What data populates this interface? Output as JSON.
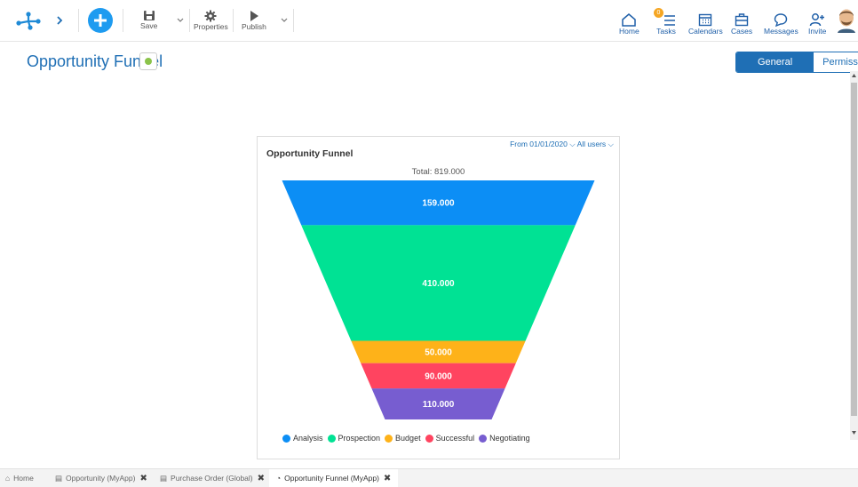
{
  "toolbar": {
    "save_label": "Save",
    "properties_label": "Properties",
    "publish_label": "Publish"
  },
  "nav": [
    {
      "label": "Home",
      "icon": "home-icon"
    },
    {
      "label": "Tasks",
      "icon": "tasks-icon",
      "badge": "0"
    },
    {
      "label": "Calendars",
      "icon": "calendar-icon"
    },
    {
      "label": "Cases",
      "icon": "briefcase-icon"
    },
    {
      "label": "Messages",
      "icon": "message-icon"
    },
    {
      "label": "Invite",
      "icon": "invite-user-icon"
    }
  ],
  "page": {
    "title": "Opportunity Funnel",
    "tabs": [
      {
        "label": "General",
        "active": true
      },
      {
        "label": "Permissions",
        "active": false
      }
    ]
  },
  "card": {
    "title": "Opportunity Funnel",
    "filter_date": "From 01/01/2020",
    "filter_users": "All users",
    "total_label": "Total: 819.000"
  },
  "chart_data": {
    "type": "funnel",
    "title": "Opportunity Funnel",
    "total": 819000,
    "stages": [
      {
        "name": "Analysis",
        "value": 159000,
        "label": "159.000",
        "color": "#0c8ef5"
      },
      {
        "name": "Prospection",
        "value": 410000,
        "label": "410.000",
        "color": "#00e294"
      },
      {
        "name": "Budget",
        "value": 50000,
        "label": "50.000",
        "color": "#feb219"
      },
      {
        "name": "Successful",
        "value": 90000,
        "label": "90.000",
        "color": "#ff4460"
      },
      {
        "name": "Negotiating",
        "value": 110000,
        "label": "110.000",
        "color": "#775dd0"
      }
    ],
    "legend_placement": "bottom"
  },
  "bottom_tabs": [
    {
      "label": "Home",
      "closable": false,
      "active": false
    },
    {
      "label": "Opportunity (MyApp)",
      "closable": true,
      "active": false
    },
    {
      "label": "Purchase Order (Global)",
      "closable": true,
      "active": false
    },
    {
      "label": "Opportunity Funnel (MyApp)",
      "closable": true,
      "active": true
    }
  ]
}
